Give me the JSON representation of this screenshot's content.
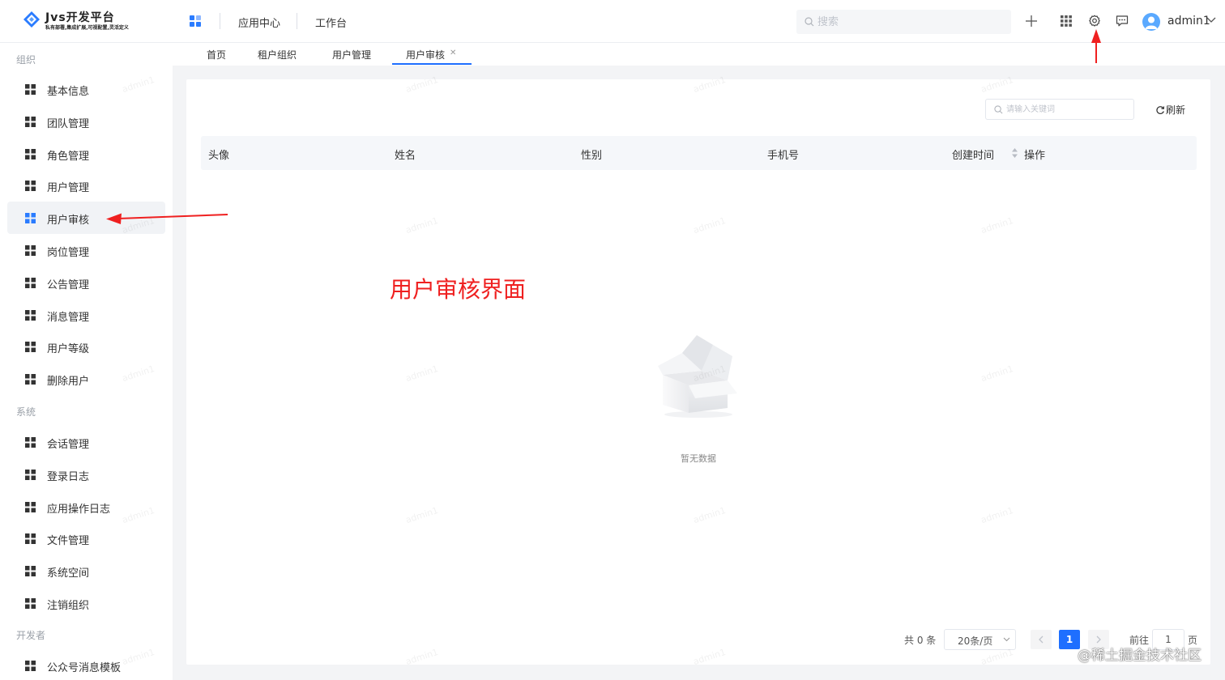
{
  "brand": {
    "title": "Jvs开发平台",
    "subtitle": "私有部署,集成扩展,可视配置,灵活定义",
    "accent": "#1e6fff"
  },
  "header": {
    "nav": [
      "应用中心",
      "工作台"
    ],
    "search_placeholder": "搜索",
    "icons": [
      "plus-icon",
      "app-grid-icon",
      "gear-icon",
      "message-icon"
    ],
    "user": "admin1"
  },
  "sidebar": {
    "groups": [
      {
        "label": "组织",
        "items": [
          "基本信息",
          "团队管理",
          "角色管理",
          "用户管理",
          "用户审核",
          "岗位管理",
          "公告管理",
          "消息管理",
          "用户等级",
          "删除用户"
        ]
      },
      {
        "label": "系统",
        "items": [
          "会话管理",
          "登录日志",
          "应用操作日志",
          "文件管理",
          "系统空间",
          "注销组织"
        ]
      },
      {
        "label": "开发者",
        "items": [
          "公众号消息模板"
        ]
      }
    ],
    "active_item": "用户审核"
  },
  "tabs": {
    "items": [
      "首页",
      "租户组织",
      "用户管理",
      "用户审核"
    ],
    "active": "用户审核"
  },
  "toolbar": {
    "keyword_placeholder": "请输入关键词",
    "refresh_label": "刷新"
  },
  "table": {
    "columns": [
      "头像",
      "姓名",
      "性别",
      "手机号",
      "创建时间",
      "操作"
    ],
    "rows": [],
    "empty_text": "暂无数据"
  },
  "pagination": {
    "total_text": "共 0 条",
    "page_size": "20条/页",
    "current_page": "1",
    "goto_prefix": "前往",
    "goto_value": "1",
    "goto_suffix": "页"
  },
  "watermark": "admin1",
  "annotation": {
    "text": "用户审核界面",
    "color": "#ef2020"
  },
  "credit": "@稀土掘金技术社区"
}
